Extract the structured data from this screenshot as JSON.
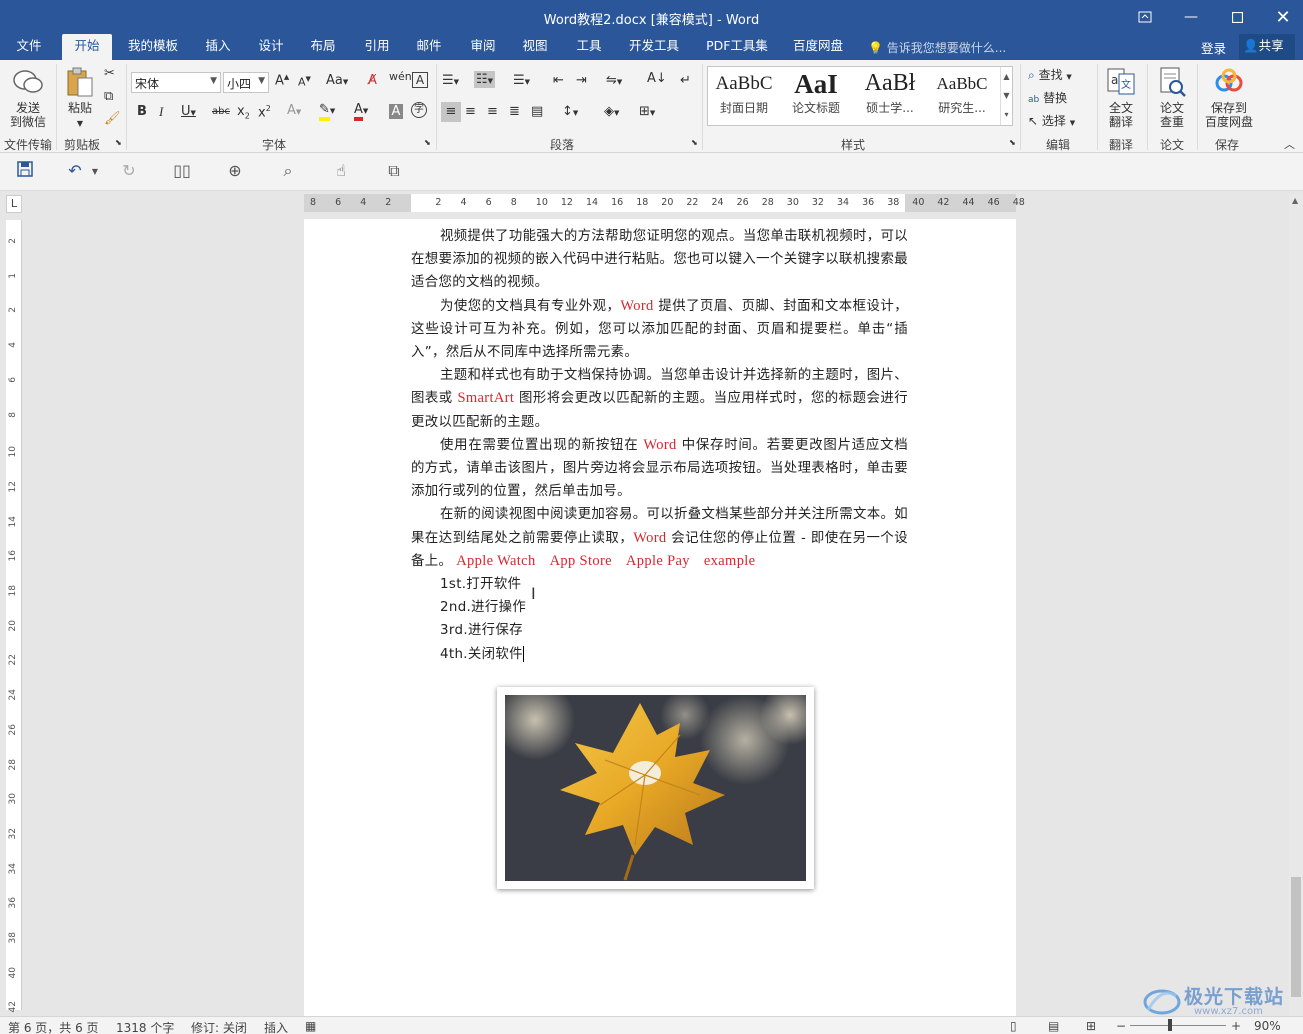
{
  "window": {
    "title": "Word教程2.docx [兼容模式] - Word"
  },
  "tabs": [
    "文件",
    "开始",
    "我的模板",
    "插入",
    "设计",
    "布局",
    "引用",
    "邮件",
    "审阅",
    "视图",
    "工具",
    "开发工具",
    "PDF工具集",
    "百度网盘"
  ],
  "active_tab": "开始",
  "tell_me": "告诉我您想要做什么...",
  "login": "登录",
  "share": "共享",
  "ribbon": {
    "send_wechat": "发送\n到微信",
    "send_wechat_l1": "发送",
    "send_wechat_l2": "到微信",
    "paste": "粘贴",
    "font_name": "宋体",
    "font_size": "小四",
    "groups": {
      "file_transfer": "文件传输",
      "clipboard": "剪贴板",
      "font": "字体",
      "paragraph": "段落",
      "styles": "样式",
      "editing": "编辑",
      "translate": "翻译",
      "paper": "论文",
      "save": "保存"
    },
    "styles": [
      {
        "preview": "AaBbC",
        "name": "封面日期"
      },
      {
        "preview": "AaI",
        "name": "论文标题"
      },
      {
        "preview": "AaBł",
        "name": "硕士学..."
      },
      {
        "preview": "AaBbC",
        "name": "研究生..."
      }
    ],
    "find": "查找",
    "replace": "替换",
    "select": "选择",
    "full_translate_l1": "全文",
    "full_translate_l2": "翻译",
    "paper_check_l1": "论文",
    "paper_check_l2": "查重",
    "save_baidu_l1": "保存到",
    "save_baidu_l2": "百度网盘"
  },
  "ruler": {
    "h_labels": [
      "8",
      "6",
      "4",
      "2",
      "2",
      "4",
      "6",
      "8",
      "10",
      "12",
      "14",
      "16",
      "18",
      "20",
      "22",
      "24",
      "26",
      "28",
      "30",
      "32",
      "34",
      "36",
      "38",
      "40",
      "42",
      "44",
      "46",
      "48"
    ],
    "v_labels": [
      "2",
      "1",
      "2",
      "4",
      "6",
      "8",
      "10",
      "12",
      "14",
      "16",
      "18",
      "20",
      "22",
      "24",
      "26",
      "28",
      "30",
      "32",
      "34",
      "36",
      "38",
      "40",
      "42"
    ]
  },
  "document": {
    "p1": "视频提供了功能强大的方法帮助您证明您的观点。当您单击联机视频时，可以在想要添加的视频的嵌入代码中进行粘贴。您也可以键入一个关键字以联机搜索最适合您的文档的视频。",
    "p2_a": "为使您的文档具有专业外观，",
    "p2_word": "Word",
    "p2_b": " 提供了页眉、页脚、封面和文本框设计，这些设计可互为补充。例如，您可以添加匹配的封面、页眉和提要栏。单击“插入”，然后从不同库中选择所需元素。",
    "p3_a": "主题和样式也有助于文档保持协调。当您单击设计并选择新的主题时，图片、图表或 ",
    "p3_smartart": "SmartArt",
    "p3_b": " 图形将会更改以匹配新的主题。当应用样式时，您的标题会进行更改以匹配新的主题。",
    "p4_a": "使用在需要位置出现的新按钮在 ",
    "p4_word": "Word",
    "p4_b": " 中保存时间。若要更改图片适应文档的方式，请单击该图片，图片旁边将会显示布局选项按钮。当处理表格时，单击要添加行或列的位置，然后单击加号。",
    "p5_a": "在新的阅读视图中阅读更加容易。可以折叠文档某些部分并关注所需文本。如果在达到结尾处之前需要停止读取，",
    "p5_word": "Word",
    "p5_b": " 会记住您的停止位置 - 即使在另一个设备上。",
    "p5_apple_watch": "Apple Watch",
    "p5_app_store": "App Store",
    "p5_apple_pay": "Apple Pay",
    "p5_example": "example",
    "list": [
      "1st.打开软件",
      "2nd.进行操作",
      "3rd.进行保存",
      "4th.关闭软件"
    ]
  },
  "statusbar": {
    "page": "第 6 页，共 6 页",
    "words": "1318 个字",
    "revision": "修订: 关闭",
    "insert": "插入",
    "zoom": "90%"
  },
  "watermark": {
    "text": "极光下载站",
    "url": "www.xz7.com"
  },
  "colors": {
    "brand": "#2b579a",
    "accent_red": "#d9262e"
  }
}
